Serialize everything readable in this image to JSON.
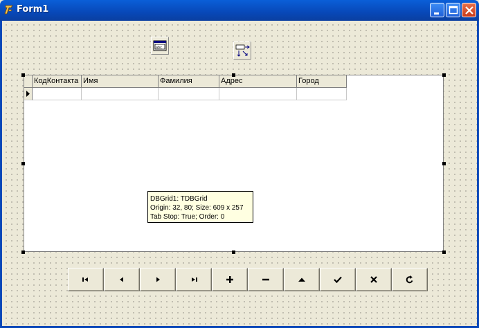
{
  "window": {
    "title": "Form1"
  },
  "grid": {
    "columns": [
      "КодКонтакта",
      "Имя",
      "Фамилия",
      "Адрес",
      "Город"
    ]
  },
  "tooltip": {
    "line1": "DBGrid1: TDBGrid",
    "line2": "Origin: 32, 80; Size: 609 x 257",
    "line3": "Tab Stop: True; Order: 0"
  },
  "nonvisual_components": [
    "datasource-icon",
    "query-icon"
  ],
  "navigator": {
    "buttons": [
      "first",
      "prior",
      "next",
      "last",
      "insert",
      "delete",
      "edit",
      "post",
      "cancel",
      "refresh"
    ]
  }
}
